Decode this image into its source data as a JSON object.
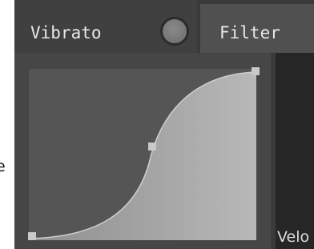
{
  "stray_label": "e",
  "tabs": {
    "vibrato": {
      "label": "Vibrato",
      "toggle_state": "off"
    },
    "filter": {
      "label": "Filter"
    }
  },
  "curve_editor": {
    "shape": "s-curve",
    "fill_color": "#a8a8a8",
    "background_color": "#555555"
  },
  "right_panel": {
    "label": "Velo"
  },
  "colors": {
    "panel": "#3a3a3a",
    "tab_active": "#404040",
    "tab_inactive": "#505050",
    "text": "#e8e8e8",
    "handle": "#c9c9c9"
  }
}
